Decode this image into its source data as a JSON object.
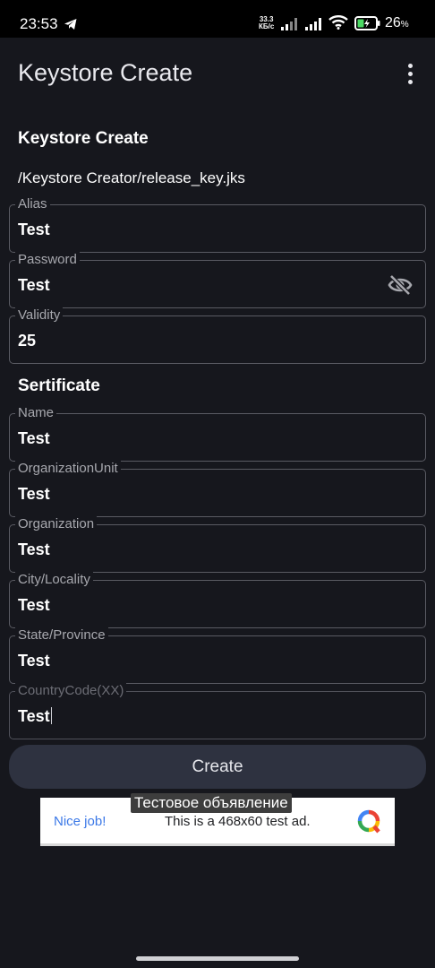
{
  "status_bar": {
    "time": "23:53",
    "speed_value": "33.3",
    "speed_unit": "КБ/с",
    "battery_value": "26",
    "battery_unit": "%"
  },
  "app_bar": {
    "title": "Keystore Create",
    "menu_icon": "more-vert-icon"
  },
  "keystore": {
    "section_title": "Keystore Create",
    "path": "/Keystore Creator/release_key.jks",
    "fields": {
      "alias": {
        "label": "Alias",
        "value": "Test"
      },
      "password": {
        "label": "Password",
        "value": "Test"
      },
      "validity": {
        "label": "Validity",
        "value": "25"
      }
    }
  },
  "certificate": {
    "section_title": "Sertificate",
    "fields": {
      "name": {
        "label": "Name",
        "value": "Test"
      },
      "org_unit": {
        "label": "OrganizationUnit",
        "value": "Test"
      },
      "organization": {
        "label": "Organization",
        "value": "Test"
      },
      "city": {
        "label": "City/Locality",
        "value": "Test"
      },
      "state": {
        "label": "State/Province",
        "value": "Test"
      },
      "country": {
        "label": "CountryCode(XX)",
        "value": "Test"
      }
    }
  },
  "create_button": {
    "label": "Create"
  },
  "ad": {
    "tooltip": "Тестовое объявление",
    "nice_job": "Nice job!",
    "text": "This is a 468x60 test ad."
  },
  "colors": {
    "background": "#16171d",
    "field_border": "#5a5b63",
    "button_bg": "#2e3240",
    "ad_link": "#3b78e7"
  }
}
